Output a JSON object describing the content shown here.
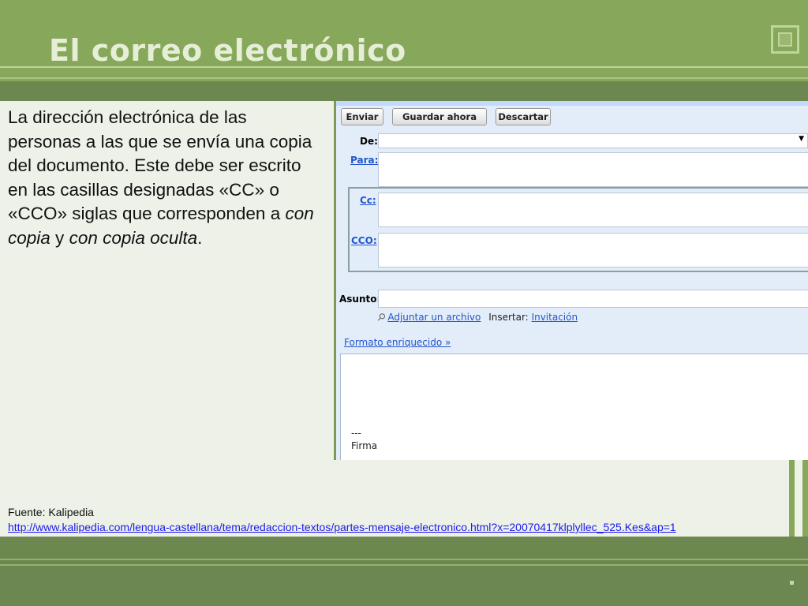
{
  "slide": {
    "title": "El correo electrónico",
    "description": {
      "part1": "La dirección electrónica de las personas a las que se envía una copia del documento. Este debe ser escrito en las casillas designadas «CC» o «CCO» siglas que corresponden a ",
      "em1": "con copia",
      "part2": " y ",
      "em2": "con copia oculta",
      "part3": "."
    },
    "source_label": "Fuente: Kalipedia",
    "source_url": "http://www.kalipedia.com/lengua-castellana/tema/redaccion-textos/partes-mensaje-electronico.html?x=20070417klplyllec_525.Kes&ap=1"
  },
  "email": {
    "buttons": {
      "send": "Enviar",
      "save": "Guardar ahora",
      "discard": "Descartar"
    },
    "labels": {
      "from": "De:",
      "to": "Para:",
      "cc": "Cc:",
      "bcc": "CCO:",
      "subject": "Asunto:"
    },
    "attach_link": "Adjuntar un archivo",
    "insert_label": "Insertar:",
    "invitation_link": "Invitación",
    "rich_format_link": "Formato enriquecido »",
    "signature_separator": "---",
    "signature": "Firma",
    "from_value": "",
    "to_value": "",
    "cc_value": "",
    "bcc_value": "",
    "subject_value": "",
    "body_value": ""
  },
  "colors": {
    "header_green": "#87a85a",
    "dark_green": "#6c8750",
    "link_blue": "#2255cc",
    "mail_bg": "#e3edf9"
  }
}
